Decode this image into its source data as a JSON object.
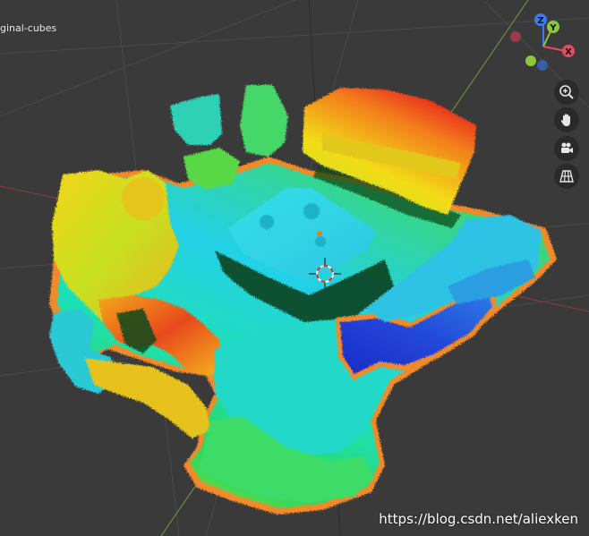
{
  "viewport": {
    "object_name": "ginal-cubes",
    "background_color": "#3a3a3a"
  },
  "gizmo": {
    "x_label": "X",
    "y_label": "Y",
    "z_label": "Z",
    "x_color": "#e84a5f",
    "y_color": "#8cc63f",
    "z_color": "#3d7be8"
  },
  "navigation": {
    "buttons": [
      "zoom-icon",
      "hand-pan-icon",
      "camera-icon",
      "grid-icon"
    ]
  },
  "watermark": "https://blog.csdn.net/aliexken"
}
